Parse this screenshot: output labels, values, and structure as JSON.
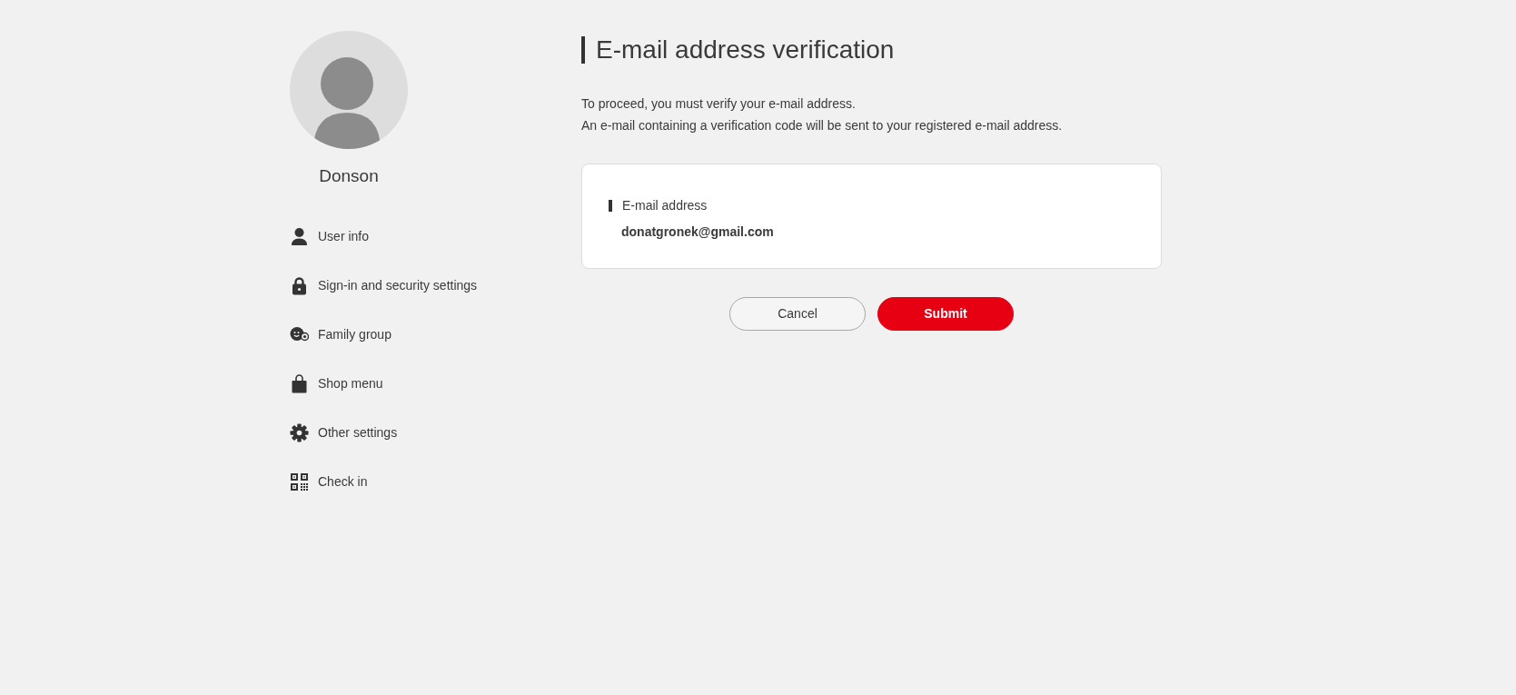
{
  "sidebar": {
    "user_name": "Donson",
    "items": [
      {
        "label": "User info"
      },
      {
        "label": "Sign-in and security settings"
      },
      {
        "label": "Family group"
      },
      {
        "label": "Shop menu"
      },
      {
        "label": "Other settings"
      },
      {
        "label": "Check in"
      }
    ]
  },
  "main": {
    "title": "E-mail address verification",
    "paragraphs": [
      "To proceed, you must verify your e-mail address.",
      "An e-mail containing a verification code will be sent to your registered e-mail address."
    ],
    "card": {
      "label": "E-mail address",
      "value": "donatgronek@gmail.com"
    },
    "buttons": [
      {
        "label": "Cancel",
        "kind": "secondary"
      },
      {
        "label": "Submit",
        "kind": "primary"
      }
    ]
  }
}
